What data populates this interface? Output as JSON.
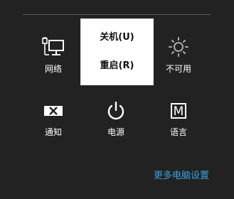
{
  "settings_panel": {
    "tiles": {
      "network": {
        "label": "网络",
        "icon": "network-monitor-icon"
      },
      "brightness": {
        "label": "不可用",
        "icon": "brightness-sun-icon"
      },
      "notifications": {
        "label": "通知",
        "icon": "notifications-off-icon"
      },
      "power": {
        "label": "电源",
        "icon": "power-icon"
      },
      "language": {
        "label": "语言",
        "icon": "keyboard-language-icon",
        "glyph": "M"
      }
    },
    "power_menu": {
      "shutdown_label": "关机(U)",
      "restart_label": "重启(R)"
    },
    "more_settings_link": "更多电脑设置"
  },
  "colors": {
    "background": "#222222",
    "menu_background": "#ffffff",
    "link": "#3aa2dd",
    "text": "#ffffff"
  }
}
